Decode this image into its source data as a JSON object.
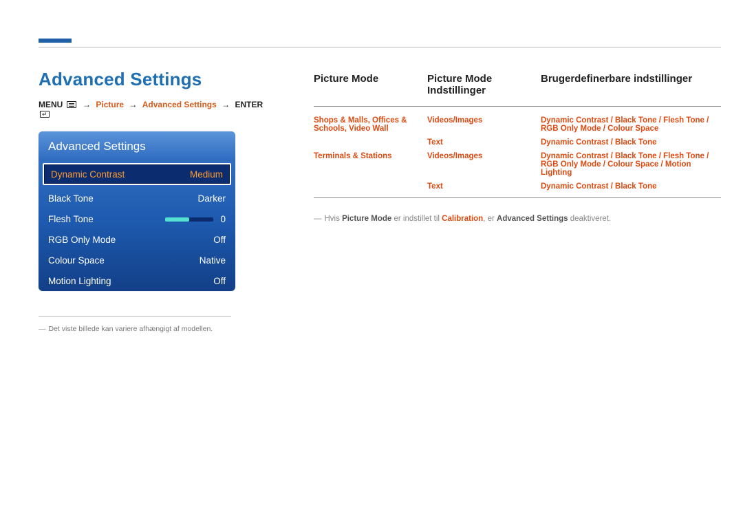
{
  "page": {
    "title": "Advanced Settings",
    "breadcrumb": {
      "menu": "MENU",
      "picture": "Picture",
      "advanced": "Advanced Settings",
      "enter": "ENTER"
    },
    "footnote": "Det viste billede kan variere afhængigt af modellen."
  },
  "osd": {
    "title": "Advanced Settings",
    "rows": [
      {
        "label": "Dynamic Contrast",
        "value": "Medium",
        "selected": true
      },
      {
        "label": "Black Tone",
        "value": "Darker"
      },
      {
        "label": "Flesh Tone",
        "value": "0",
        "slider": true
      },
      {
        "label": "RGB Only Mode",
        "value": "Off"
      },
      {
        "label": "Colour Space",
        "value": "Native"
      },
      {
        "label": "Motion Lighting",
        "value": "Off"
      }
    ]
  },
  "table": {
    "headers": {
      "c1": "Picture Mode",
      "c2": "Picture Mode Indstillinger",
      "c3": "Brugerdefinerbare indstillinger"
    },
    "rows": [
      {
        "c1_parts": [
          "Shops & Malls",
          "Offices & Schools",
          "Video Wall"
        ],
        "c2": "Videos/Images",
        "c3_parts": [
          "Dynamic Contrast",
          "Black Tone",
          "Flesh Tone",
          "RGB Only Mode",
          "Colour Space"
        ]
      },
      {
        "c1_parts": [],
        "c2": "Text",
        "c3_parts": [
          "Dynamic Contrast",
          "Black Tone"
        ]
      },
      {
        "c1_parts": [
          "Terminals & Stations"
        ],
        "c2": "Videos/Images",
        "c3_parts": [
          "Dynamic Contrast",
          "Black Tone",
          "Flesh Tone",
          "RGB Only Mode",
          "Colour Space",
          "Motion Lighting"
        ]
      },
      {
        "c1_parts": [],
        "c2": "Text",
        "c3_parts": [
          "Dynamic Contrast",
          "Black Tone"
        ]
      }
    ],
    "note": {
      "pre": "Hvis ",
      "picture_mode": "Picture Mode",
      "mid": " er indstillet til ",
      "calibration": "Calibration",
      "mid2": ", er ",
      "adv": "Advanced Settings",
      "post": " deaktiveret."
    }
  }
}
